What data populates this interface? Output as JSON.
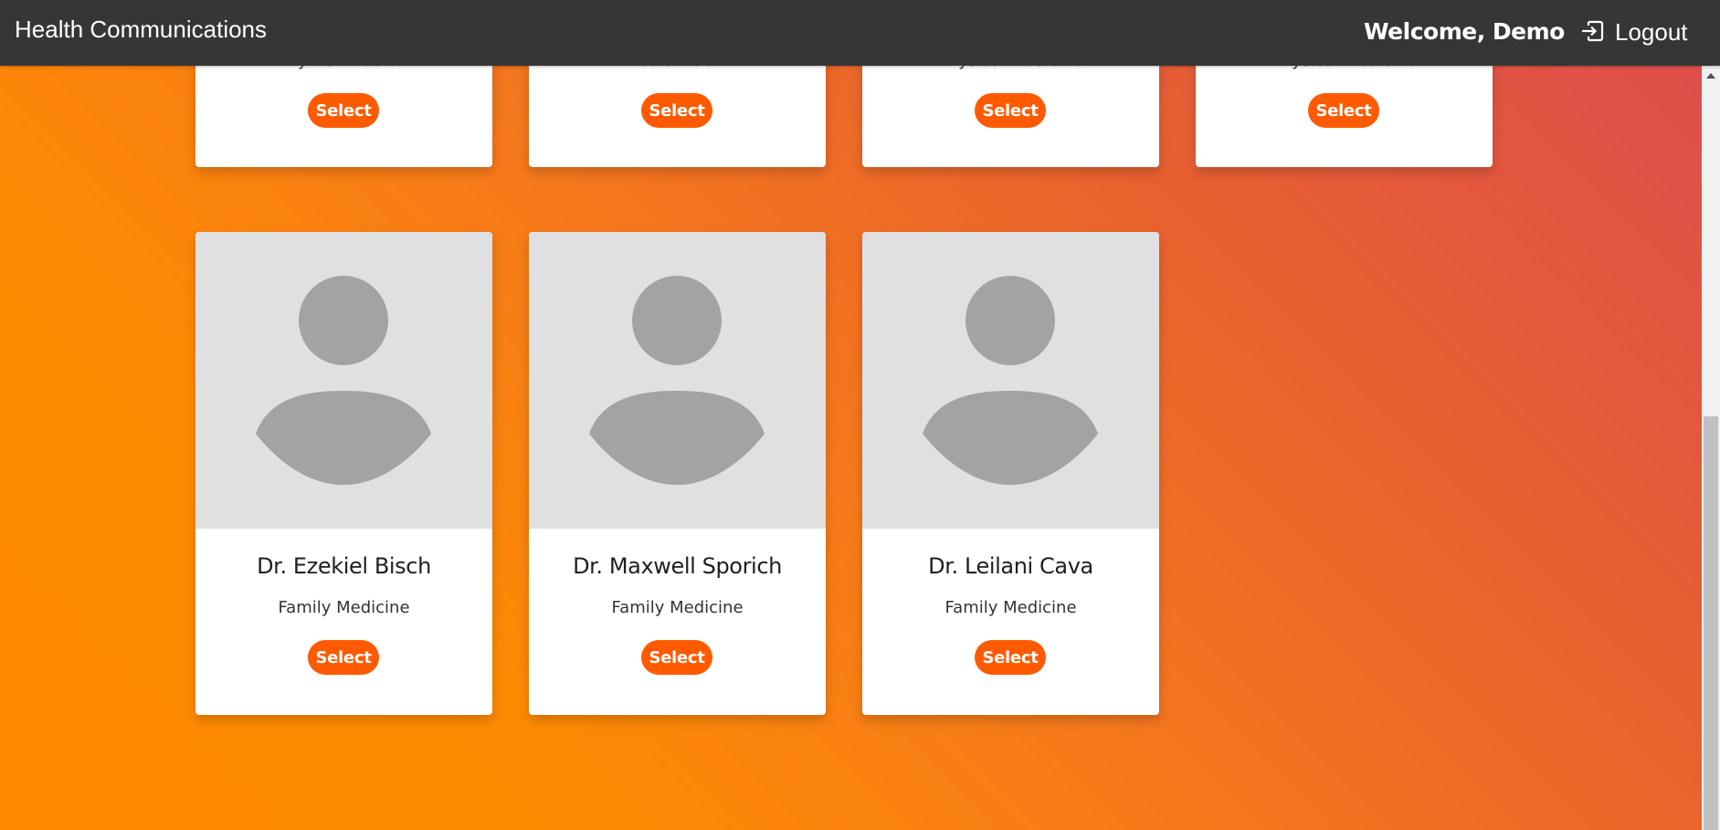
{
  "app": {
    "brand": "Health Communications",
    "welcome": "Welcome, Demo",
    "logout_label": "Logout"
  },
  "colors": {
    "navbar": "#363636",
    "accent": "#ff5a00",
    "photo_bg": "#e0e0e0",
    "avatar": "#a3a3a3"
  },
  "icons": {
    "logout": "logout-icon",
    "avatar": "person-placeholder-icon"
  },
  "doctors_top": [
    {
      "name": "",
      "specialty": "My PCP Doctor",
      "select_label": "Select"
    },
    {
      "name": "",
      "specialty": "Pediatrician",
      "select_label": "Select"
    },
    {
      "name": "",
      "specialty": "Physical Medicine",
      "select_label": "Select"
    },
    {
      "name": "",
      "specialty": "Physical Medicine",
      "select_label": "Select"
    }
  ],
  "doctors_bottom": [
    {
      "name": "Dr. Ezekiel Bisch",
      "specialty": "Family Medicine",
      "select_label": "Select"
    },
    {
      "name": "Dr. Maxwell Sporich",
      "specialty": "Family Medicine",
      "select_label": "Select"
    },
    {
      "name": "Dr. Leilani Cava",
      "specialty": "Family Medicine",
      "select_label": "Select"
    }
  ]
}
